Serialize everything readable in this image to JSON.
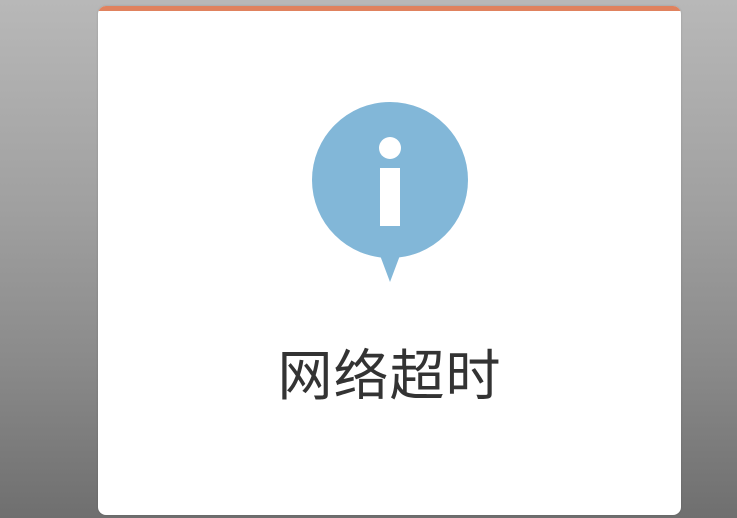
{
  "dialog": {
    "accent_color": "#e0825e",
    "icon": {
      "name": "info-icon",
      "color": "#82b7d8"
    },
    "message": "网络超时"
  }
}
